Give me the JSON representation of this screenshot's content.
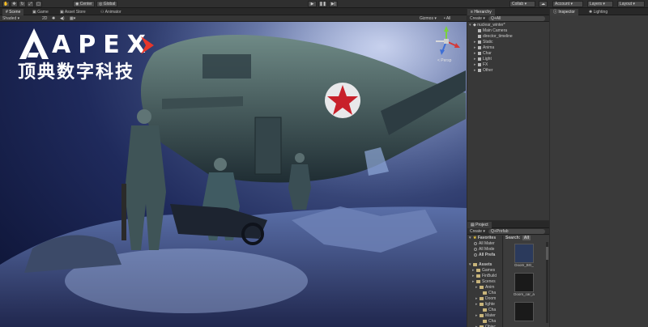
{
  "toolbar": {
    "center_label": "Center",
    "global_label": "Global",
    "collab_label": "Collab",
    "account_label": "Account",
    "layers_label": "Layers",
    "layout_label": "Layout",
    "icons": [
      "hand-icon",
      "move-icon",
      "rotate-icon",
      "scale-icon",
      "rect-tool-icon",
      "play-icon",
      "pause-icon",
      "step-icon",
      "cloud-icon"
    ]
  },
  "tabs": {
    "scene": "Scene",
    "game": "Game",
    "asset_store": "Asset Store",
    "animator": "Animator",
    "hierarchy": "Hierarchy",
    "inspector": "Inspector",
    "lighting": "Lighting",
    "project": "Project"
  },
  "scene_toolbar": {
    "shading": "Shaded",
    "mode_2d": "2D",
    "gizmos": "Gizmos",
    "search": "• All"
  },
  "viewport": {
    "logo_text": "APEX",
    "logo_sub": "顶典数字科技",
    "persp_label": "< Persp",
    "accent_color": "#e8362a"
  },
  "hierarchy": {
    "create_label": "Create",
    "search_label": "Q+All",
    "scene_name": "nuclear_winter*",
    "items": [
      {
        "label": "Main Camera",
        "indent": 1,
        "expandable": false
      },
      {
        "label": "director_timeline",
        "indent": 1,
        "expandable": false
      },
      {
        "label": "Static",
        "indent": 1,
        "expandable": true
      },
      {
        "label": "Anima",
        "indent": 1,
        "expandable": true
      },
      {
        "label": "Char",
        "indent": 1,
        "expandable": true
      },
      {
        "label": "Light",
        "indent": 1,
        "expandable": true
      },
      {
        "label": "FX",
        "indent": 1,
        "expandable": true
      },
      {
        "label": "Other",
        "indent": 1,
        "expandable": true
      }
    ]
  },
  "project": {
    "create_label": "Create",
    "search_label": "Q+Prefab",
    "search_header": "Search:",
    "search_scope": "All",
    "favorites_label": "Favorites",
    "favorites": [
      "All Mater",
      "All Mode",
      "All Prefa"
    ],
    "assets_label": "Assets",
    "assets_tree": [
      {
        "label": "Games",
        "indent": 1
      },
      {
        "label": "FinBuild",
        "indent": 1
      },
      {
        "label": "Scenes",
        "indent": 1
      },
      {
        "label": "Anim",
        "indent": 2
      },
      {
        "label": "Cha",
        "indent": 3
      },
      {
        "label": "Doom",
        "indent": 2
      },
      {
        "label": "lighte",
        "indent": 2
      },
      {
        "label": "Cha",
        "indent": 3
      },
      {
        "label": "Mater",
        "indent": 2
      },
      {
        "label": "Cha",
        "indent": 3
      },
      {
        "label": "Objec",
        "indent": 2
      },
      {
        "label": "Cha",
        "indent": 3
      }
    ],
    "thumbnails": [
      {
        "label": "Doom_BG_"
      },
      {
        "label": "Doom_car_a"
      },
      {
        "label": ""
      }
    ]
  }
}
